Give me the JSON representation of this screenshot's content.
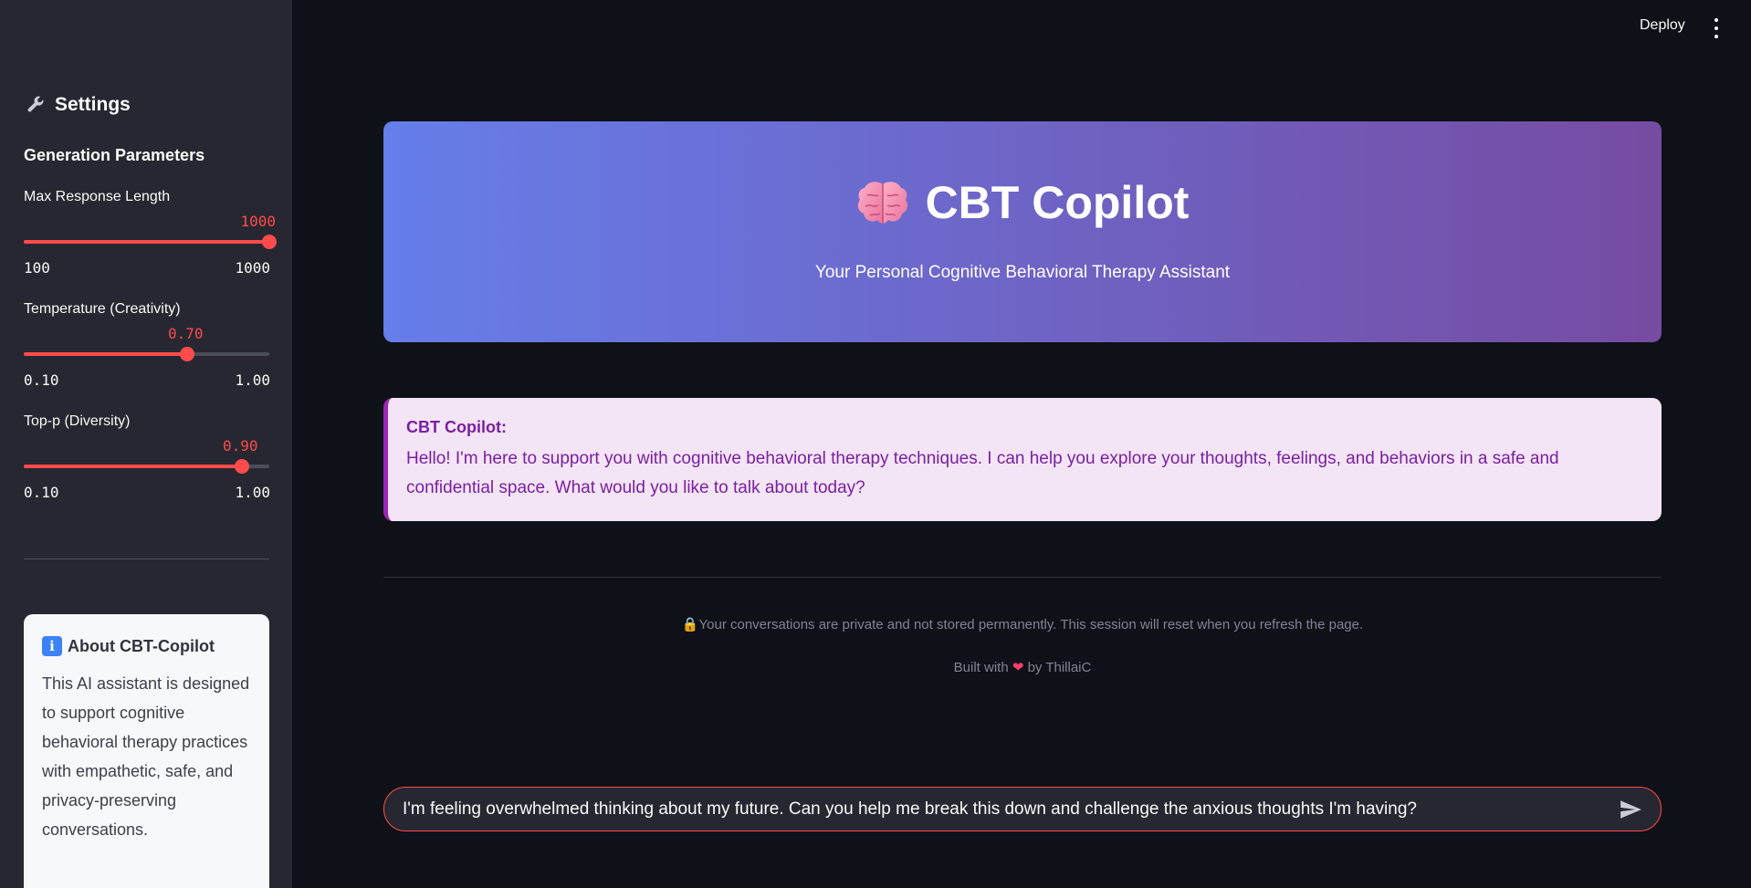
{
  "header": {
    "deploy_label": "Deploy"
  },
  "sidebar": {
    "title": "Settings",
    "section_title": "Generation Parameters",
    "sliders": [
      {
        "label": "Max Response Length",
        "value": "1000",
        "min": "100",
        "max": "1000",
        "fraction": 1.0
      },
      {
        "label": "Temperature (Creativity)",
        "value": "0.70",
        "min": "0.10",
        "max": "1.00",
        "fraction": 0.667
      },
      {
        "label": "Top-p (Diversity)",
        "value": "0.90",
        "min": "0.10",
        "max": "1.00",
        "fraction": 0.889
      }
    ],
    "about": {
      "title": "About CBT-Copilot",
      "text": "This AI assistant is designed to support cognitive behavioral therapy practices with empathetic, safe, and privacy-preserving conversations."
    }
  },
  "hero": {
    "title": "CBT Copilot",
    "subtitle": "Your Personal Cognitive Behavioral Therapy Assistant"
  },
  "message": {
    "author": "CBT Copilot:",
    "text": "Hello! I'm here to support you with cognitive behavioral therapy techniques. I can help you explore your thoughts, feelings, and behaviors in a safe and confidential space. What would you like to talk about today?"
  },
  "footer": {
    "privacy": "🔒Your conversations are private and not stored permanently. This session will reset when you refresh the page.",
    "built_prefix": "Built with",
    "built_suffix": "by ThillaiC"
  },
  "chat_input": {
    "value": "I'm feeling overwhelmed thinking about my future. Can you help me break this down and challenge the anxious thoughts I'm having?"
  },
  "colors": {
    "accent": "#ff4b4b",
    "gradient_start": "#667eea",
    "gradient_end": "#764ba2",
    "message_bg": "#f3e5f5",
    "message_text": "#7b1fa2"
  },
  "icons": {
    "settings": "wrench-icon",
    "title": "brain-icon",
    "about": "info-icon",
    "send": "send-icon",
    "menu": "kebab-menu-icon",
    "heart": "heart-icon"
  }
}
